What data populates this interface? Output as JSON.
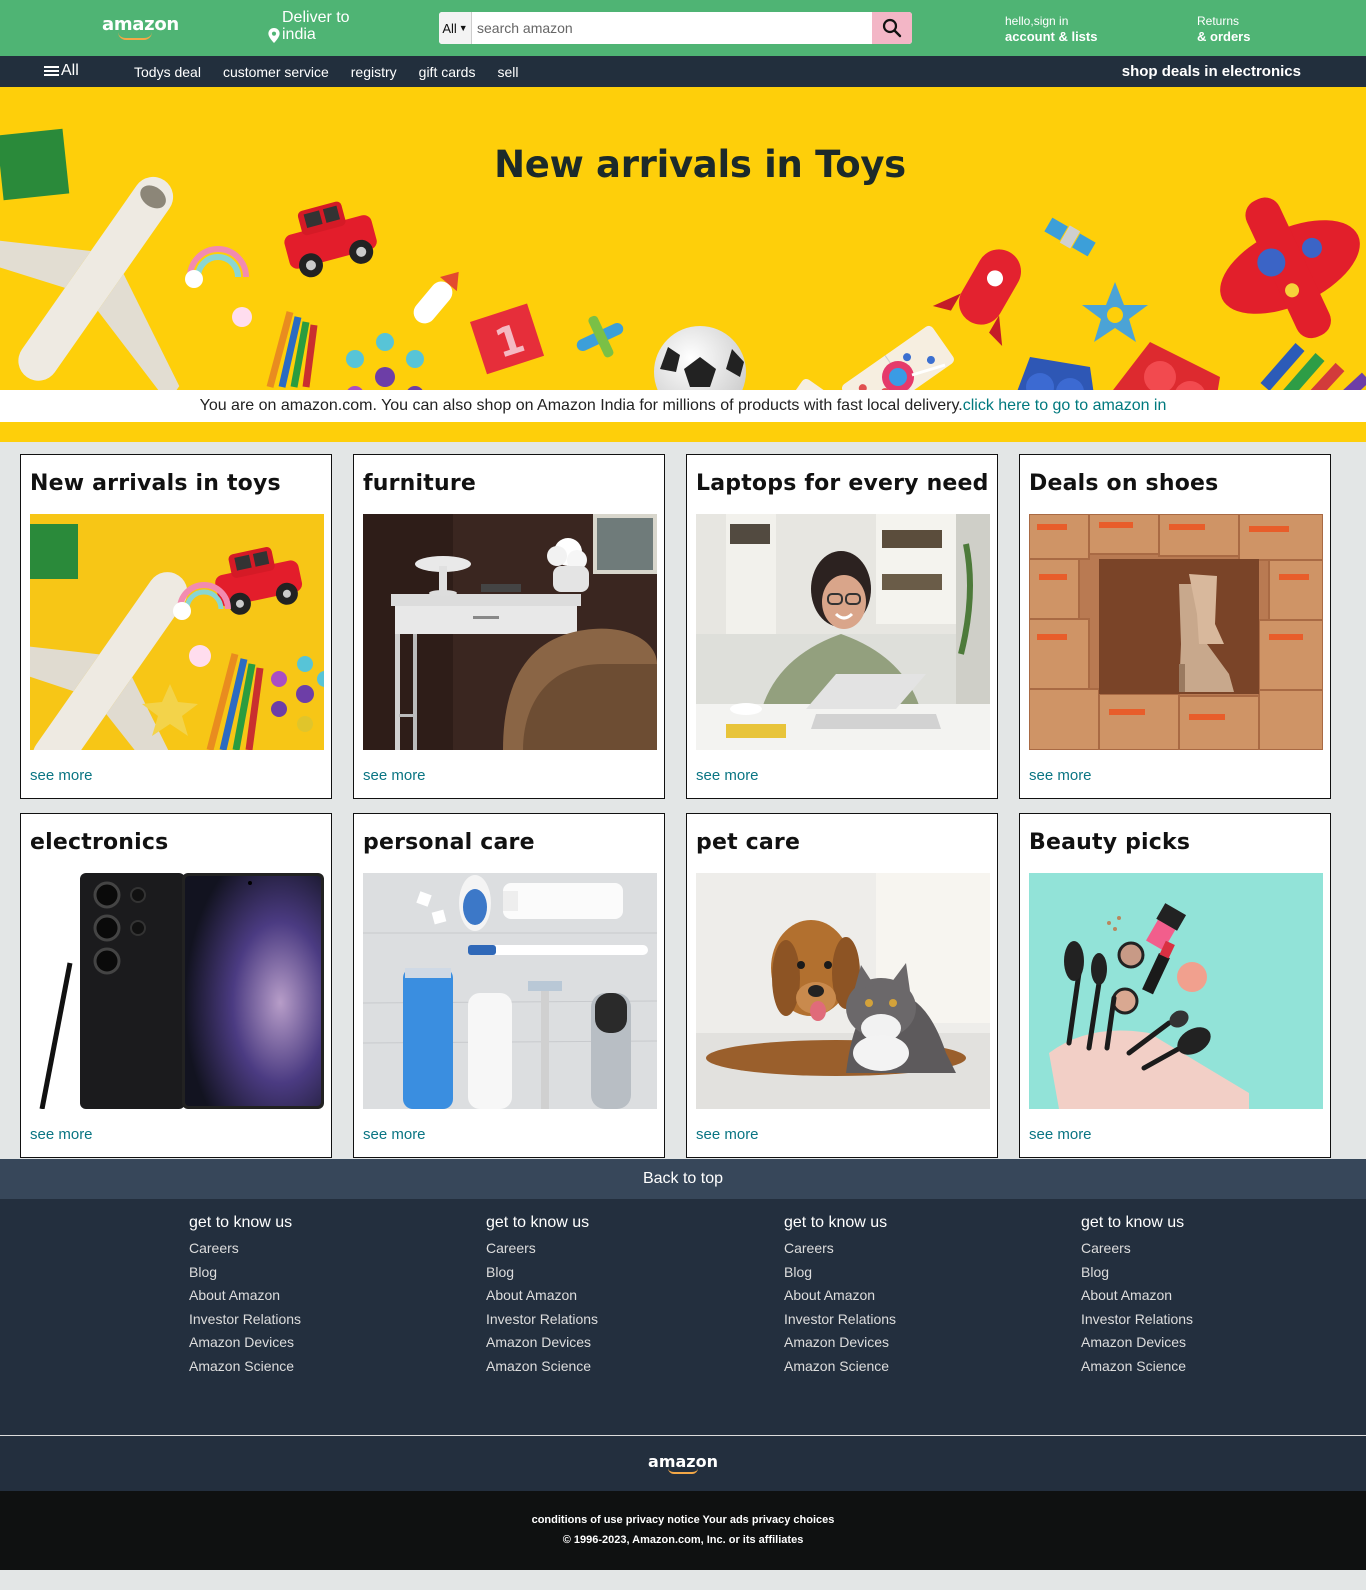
{
  "header": {
    "logo": "amazon",
    "deliver_line1": "Deliver to",
    "deliver_line2": "india",
    "search_category": "All",
    "search_placeholder": "search amazon",
    "account_line1": "hello,sign in",
    "account_line2": "account & lists",
    "returns_line1": "Returns",
    "returns_line2": "& orders"
  },
  "subnav": {
    "all_label": "All",
    "items": [
      "Todys deal",
      "customer service",
      "registry",
      "gift cards",
      "sell"
    ],
    "promo": "shop deals in electronics"
  },
  "hero": {
    "title": "New arrivals in Toys",
    "notice_text": "You are on amazon.com. You can also shop on Amazon India for millions of products with fast local delivery.",
    "notice_link": "click here to go to amazon in"
  },
  "cards": [
    {
      "title": "New arrivals in toys",
      "image": "toys-image",
      "link": "see more"
    },
    {
      "title": "furniture",
      "image": "furniture-image",
      "link": "see more"
    },
    {
      "title": "Laptops for every need",
      "image": "laptop-image",
      "link": "see more"
    },
    {
      "title": "Deals on shoes",
      "image": "shoes-image",
      "link": "see more"
    },
    {
      "title": "electronics",
      "image": "phone-image",
      "link": "see more"
    },
    {
      "title": "personal care",
      "image": "personal-care-image",
      "link": "see more"
    },
    {
      "title": "pet care",
      "image": "pet-image",
      "link": "see more"
    },
    {
      "title": "Beauty picks",
      "image": "beauty-image",
      "link": "see more"
    }
  ],
  "footer": {
    "back_to_top": "Back to top",
    "columns": [
      {
        "heading": "get to know us",
        "links": [
          "Careers",
          "Blog",
          "About Amazon",
          "Investor Relations",
          "Amazon Devices",
          "Amazon Science"
        ]
      },
      {
        "heading": "get to know us",
        "links": [
          "Careers",
          "Blog",
          "About Amazon",
          "Investor Relations",
          "Amazon Devices",
          "Amazon Science"
        ]
      },
      {
        "heading": "get to know us",
        "links": [
          "Careers",
          "Blog",
          "About Amazon",
          "Investor Relations",
          "Amazon Devices",
          "Amazon Science"
        ]
      },
      {
        "heading": "get to know us",
        "links": [
          "Careers",
          "Blog",
          "About Amazon",
          "Investor Relations",
          "Amazon Devices",
          "Amazon Science"
        ]
      }
    ],
    "logo": "amazon",
    "legal_links": "conditions of use privacy notice Your ads privacy choices",
    "copyright": "© 1996-2023, Amazon.com, Inc. or its affiliates"
  },
  "colors": {
    "header_bg": "#4fb474",
    "subnav_bg": "#222f3d",
    "hero_bg": "#fecf0a",
    "search_button": "#f3b6c6",
    "link": "#0a7583",
    "footer_bg": "#232f3e",
    "back_to_top_bg": "#37475a"
  }
}
